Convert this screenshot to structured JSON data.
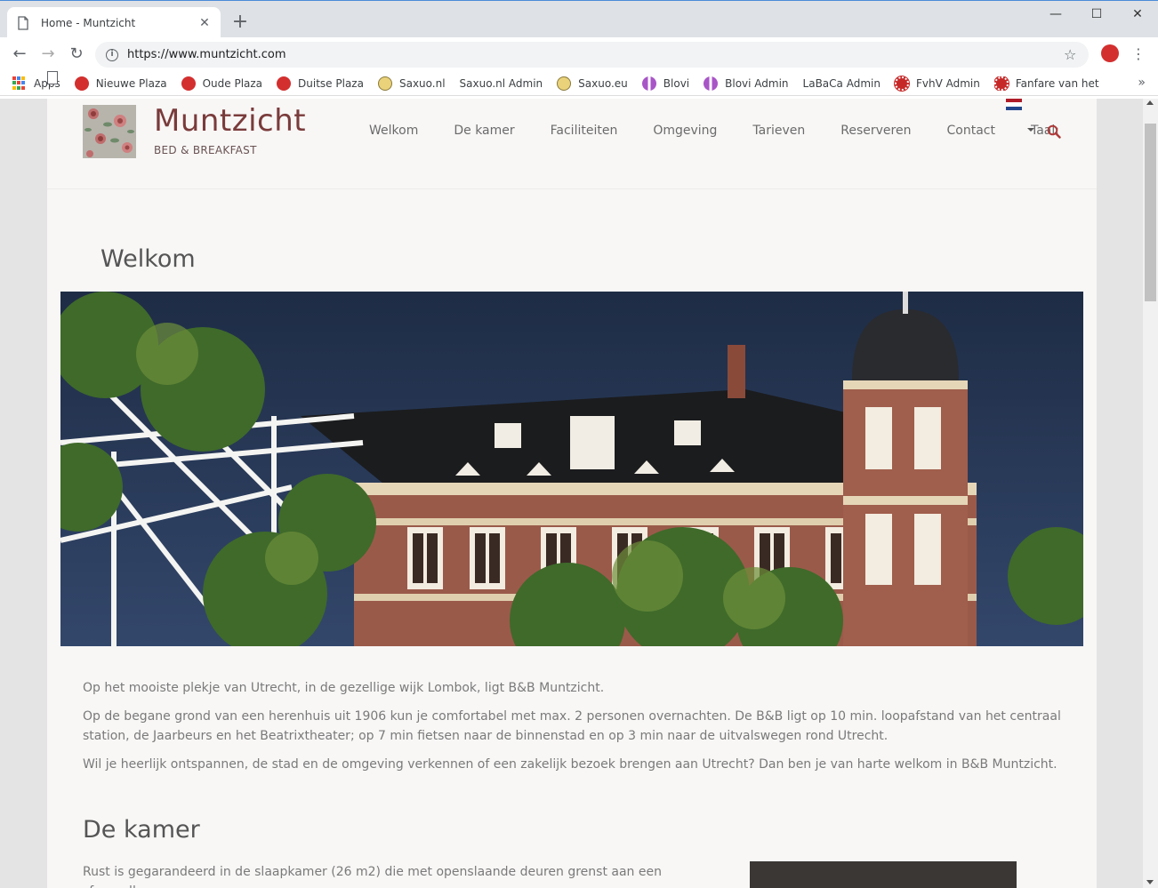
{
  "browser": {
    "tab_title": "Home - Muntzicht",
    "url": "https://www.muntzicht.com",
    "bookmarks": [
      {
        "label": "Apps",
        "icon": "apps-grid-icon"
      },
      {
        "label": "Nieuwe Plaza",
        "icon": "plaza-icon"
      },
      {
        "label": "Oude Plaza",
        "icon": "plaza-icon"
      },
      {
        "label": "Duitse Plaza",
        "icon": "plaza-icon"
      },
      {
        "label": "Saxuo.nl",
        "icon": "saxuo-icon"
      },
      {
        "label": "Saxuo.nl Admin",
        "icon": "page-icon"
      },
      {
        "label": "Saxuo.eu",
        "icon": "saxuo-icon"
      },
      {
        "label": "Blovi",
        "icon": "blovi-icon"
      },
      {
        "label": "Blovi Admin",
        "icon": "blovi-icon"
      },
      {
        "label": "LaBaCa Admin",
        "icon": "page-icon"
      },
      {
        "label": "FvhV Admin",
        "icon": "fvhv-icon"
      },
      {
        "label": "Fanfare van het Vuur",
        "icon": "fvhv-icon"
      }
    ],
    "bookmarks_more": "»"
  },
  "site": {
    "name": "Muntzicht",
    "tagline": "BED & BREAKFAST",
    "nav": [
      "Welkom",
      "De kamer",
      "Faciliteiten",
      "Omgeving",
      "Tarieven",
      "Reserveren",
      "Contact",
      "Taal:"
    ],
    "colors": {
      "brand": "#7a3b3b",
      "search": "#b03a3a"
    }
  },
  "content": {
    "welkom_heading": "Welkom",
    "welkom_paragraphs": [
      "Op het mooiste plekje van Utrecht, in de gezellige wijk Lombok, ligt B&B Muntzicht.",
      "Op de begane grond van een herenhuis uit 1906 kun je comfortabel met max. 2 personen overnachten. De B&B ligt op 10 min. loopafstand van het centraal station, de Jaarbeurs en het Beatrixtheater; op 7 min fietsen naar de binnenstad en op 3 min naar de uitvalswegen rond Utrecht.",
      "Wil je heerlijk ontspannen, de stad en de omgeving verkennen of een zakelijk bezoek brengen aan Utrecht? Dan ben je van harte welkom in B&B Muntzicht."
    ],
    "kamer_heading": "De kamer",
    "kamer_text": "Rust is gegarandeerd in de slaapkamer (26 m2) die met openslaande deuren grenst aan een sfeervolle"
  }
}
